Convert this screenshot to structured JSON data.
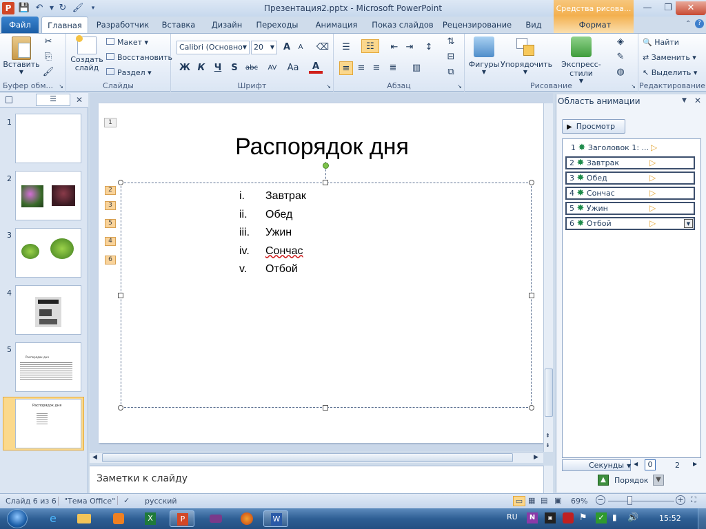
{
  "window": {
    "title": "Презентация2.pptx - Microsoft PowerPoint",
    "context_tab": "Средства рисова..."
  },
  "tabs": [
    "Файл",
    "Главная",
    "Разработчик",
    "Вставка",
    "Дизайн",
    "Переходы",
    "Анимация",
    "Показ слайдов",
    "Рецензирование",
    "Вид",
    "Формат"
  ],
  "ribbon": {
    "clipboard": {
      "paste": "Вставить",
      "label": "Буфер обм..."
    },
    "slides": {
      "create": "Создать слайд",
      "layout": "Макет",
      "reset": "Восстановить",
      "section": "Раздел",
      "label": "Слайды"
    },
    "font": {
      "name": "Calibri (Основно",
      "size": "20",
      "bold": "Ж",
      "italic": "К",
      "underline": "Ч",
      "shadow": "S",
      "strike": "abc",
      "spacing": "AV",
      "case": "Аа",
      "color": "A",
      "grow": "A",
      "shrink": "A",
      "label": "Шрифт"
    },
    "paragraph": {
      "label": "Абзац"
    },
    "drawing": {
      "shapes": "Фигуры",
      "arrange": "Упорядочить",
      "styles": "Экспресс-стили",
      "label": "Рисование"
    },
    "editing": {
      "find": "Найти",
      "replace": "Заменить",
      "select": "Выделить",
      "label": "Редактирование"
    }
  },
  "slides_pane": {
    "numbers": [
      "1",
      "2",
      "3",
      "4",
      "5",
      "6"
    ],
    "thumb5_title": "Распорядок дня",
    "thumb6_title": "Распорядок дня"
  },
  "slide": {
    "title": "Распорядок дня",
    "items": [
      {
        "n": "i.",
        "t": "Завтрак"
      },
      {
        "n": "ii.",
        "t": "Обед"
      },
      {
        "n": "iii.",
        "t": "Ужин"
      },
      {
        "n": "iv.",
        "t": "Сончас"
      },
      {
        "n": "v.",
        "t": "Отбой"
      }
    ],
    "tags": [
      "1",
      "2",
      "3",
      "5",
      "4",
      "6"
    ]
  },
  "notes": {
    "placeholder": "Заметки к слайду"
  },
  "animation_pane": {
    "header": "Область анимации",
    "play": "Просмотр",
    "items": [
      {
        "n": "1",
        "t": "Заголовок 1: ..."
      },
      {
        "n": "2",
        "t": "Завтрак"
      },
      {
        "n": "3",
        "t": "Обед"
      },
      {
        "n": "4",
        "t": "Сончас"
      },
      {
        "n": "5",
        "t": "Ужин"
      },
      {
        "n": "6",
        "t": "Отбой"
      }
    ],
    "seconds": "Секунды",
    "sec_start": "0",
    "sec_mid": "2",
    "reorder": "Порядок"
  },
  "status": {
    "slide": "Слайд 6 из 6",
    "theme": "\"Тема Office\"",
    "lang": "русский",
    "zoom": "69%"
  },
  "taskbar": {
    "lang": "RU",
    "time": "15:52"
  }
}
